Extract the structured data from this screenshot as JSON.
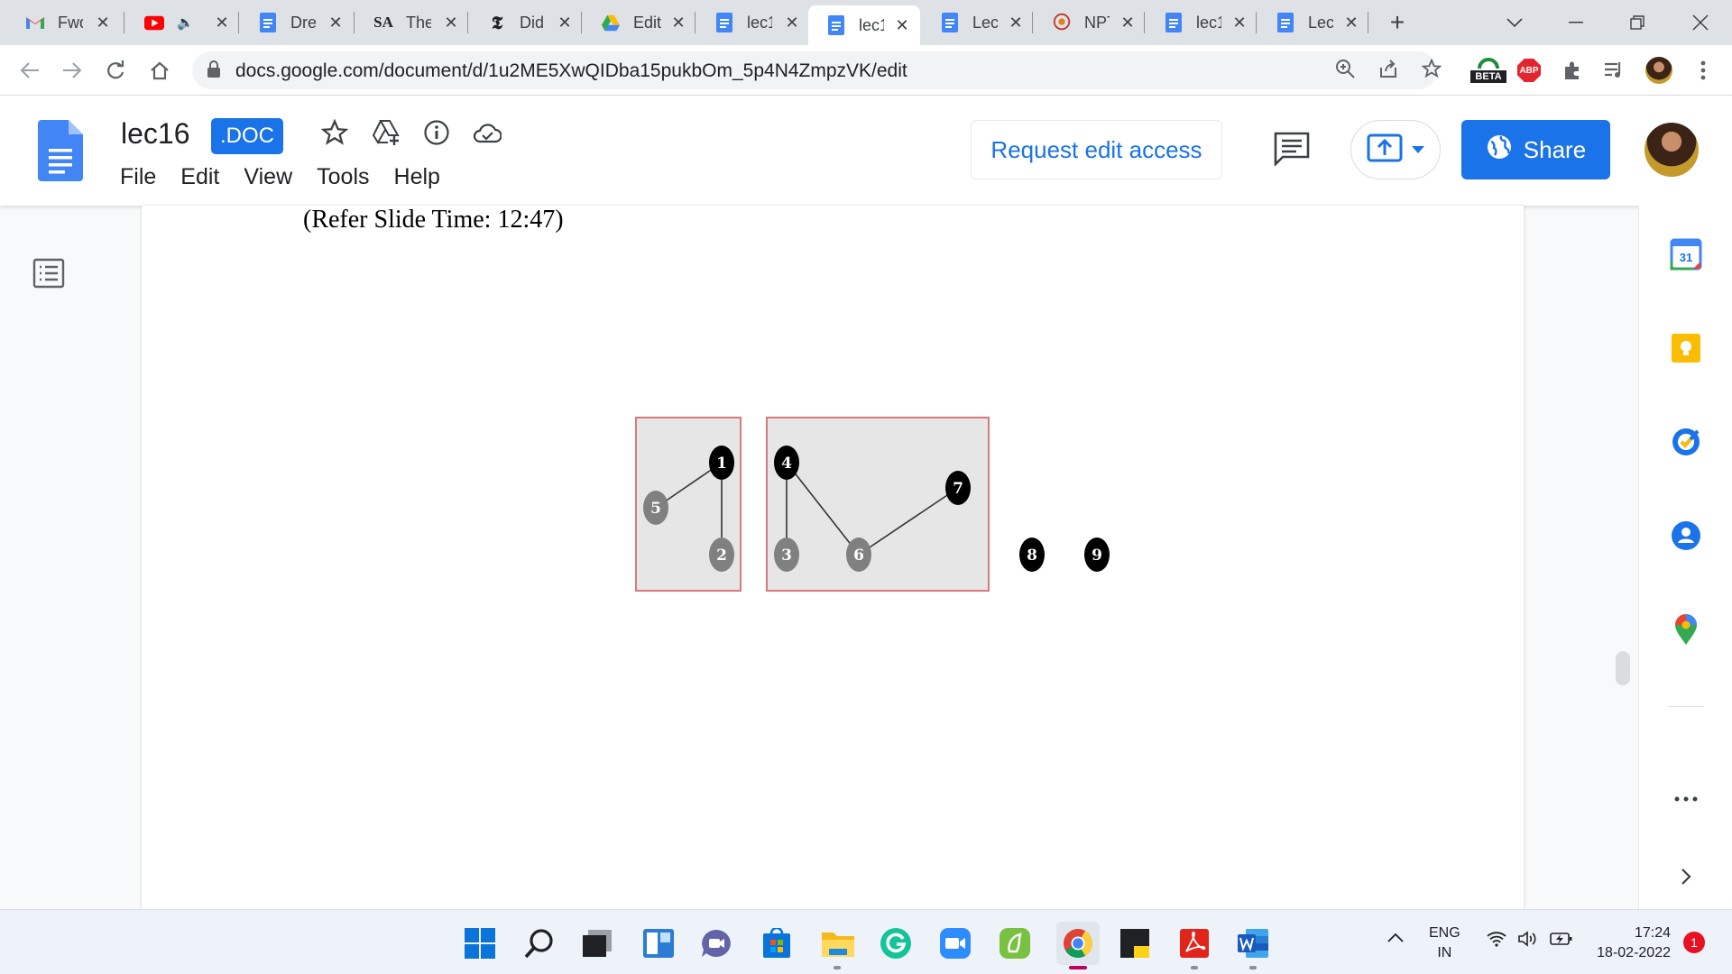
{
  "tabs": [
    {
      "title": "Fwd",
      "icon": "gmail-icon"
    },
    {
      "title": "",
      "icon": "youtube-icon",
      "muted": true
    },
    {
      "title": "Dre",
      "icon": "docs-icon"
    },
    {
      "title": "The",
      "icon": "sa-icon",
      "favicon_text": "SA"
    },
    {
      "title": "Did",
      "icon": "nyt-icon",
      "favicon_text": "𝕿"
    },
    {
      "title": "Edit",
      "icon": "drive-icon"
    },
    {
      "title": "lec1",
      "icon": "docs-icon"
    },
    {
      "title": "lec1",
      "icon": "docs-icon",
      "active": true
    },
    {
      "title": "Lec",
      "icon": "docs-icon"
    },
    {
      "title": "NPT",
      "icon": "nptel-icon"
    },
    {
      "title": "lec1",
      "icon": "docs-icon"
    },
    {
      "title": "Lec",
      "icon": "docs-icon"
    }
  ],
  "address_bar": {
    "url": "docs.google.com/document/d/1u2ME5XwQIDba15pukbOm_5p4N4ZmpzVK/edit",
    "beta_badge": "BETA",
    "abp_badge": "ABP"
  },
  "doc": {
    "title": "lec16",
    "badge": ".DOC",
    "menu": [
      "File",
      "Edit",
      "View",
      "Tools",
      "Help"
    ],
    "request_edit": "Request edit access",
    "share": "Share",
    "caption": "(Refer Slide Time: 12:47)"
  },
  "graph": {
    "nodes": [
      {
        "id": "1",
        "fill": "#000000"
      },
      {
        "id": "2",
        "fill": "#808080"
      },
      {
        "id": "5",
        "fill": "#808080"
      },
      {
        "id": "4",
        "fill": "#000000"
      },
      {
        "id": "3",
        "fill": "#808080"
      },
      {
        "id": "6",
        "fill": "#808080"
      },
      {
        "id": "7",
        "fill": "#000000"
      },
      {
        "id": "8",
        "fill": "#000000"
      },
      {
        "id": "9",
        "fill": "#000000"
      }
    ],
    "edges": [
      [
        "5",
        "1"
      ],
      [
        "1",
        "2"
      ],
      [
        "4",
        "3"
      ],
      [
        "4",
        "6"
      ],
      [
        "6",
        "7"
      ]
    ],
    "box_fill": "#e6e6e6",
    "box_stroke": "#d9797e"
  },
  "side_panel": {
    "calendar_day": "31"
  },
  "taskbar": {
    "lang_top": "ENG",
    "lang_bottom": "IN",
    "time": "17:24",
    "date": "18-02-2022",
    "notifications": "1"
  },
  "colors": {
    "accent": "#1a73e8",
    "tab_strip": "#dee1e6",
    "page": "#ffffff"
  }
}
